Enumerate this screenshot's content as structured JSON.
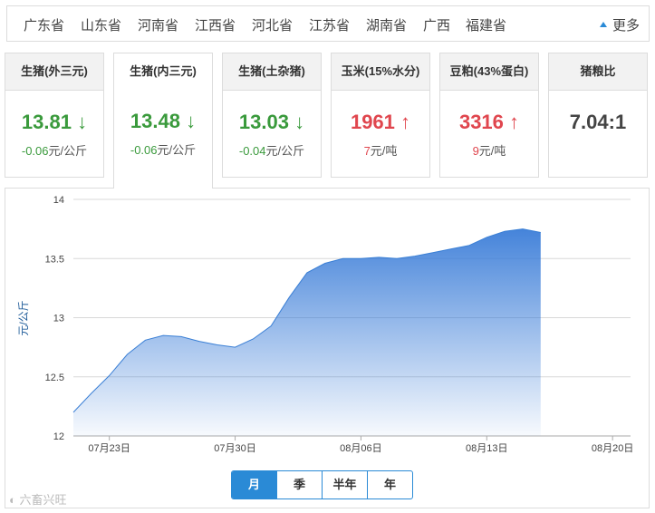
{
  "provinces": [
    "广东省",
    "山东省",
    "河南省",
    "江西省",
    "河北省",
    "江苏省",
    "湖南省",
    "广西",
    "福建省"
  ],
  "more_label": "更多",
  "cards": [
    {
      "title": "生猪(外三元)",
      "value": "13.81",
      "arrow": "↓",
      "change": "-0.06",
      "unit": "元/公斤",
      "trend": "down"
    },
    {
      "title": "生猪(内三元)",
      "value": "13.48",
      "arrow": "↓",
      "change": "-0.06",
      "unit": "元/公斤",
      "trend": "down"
    },
    {
      "title": "生猪(土杂猪)",
      "value": "13.03",
      "arrow": "↓",
      "change": "-0.04",
      "unit": "元/公斤",
      "trend": "down"
    },
    {
      "title": "玉米(15%水分)",
      "value": "1961",
      "arrow": "↑",
      "change": "7",
      "unit": "元/吨",
      "trend": "up"
    },
    {
      "title": "豆粕(43%蛋白)",
      "value": "3316",
      "arrow": "↑",
      "change": "9",
      "unit": "元/吨",
      "trend": "up"
    },
    {
      "title": "猪粮比",
      "value": "7.04:1",
      "arrow": "",
      "change": "",
      "unit": "",
      "trend": "neutral"
    }
  ],
  "active_card": 1,
  "range_buttons": [
    "月",
    "季",
    "半年",
    "年"
  ],
  "active_range": 0,
  "watermark": "六畜兴旺",
  "colors": {
    "accent": "#2a8ad6",
    "down": "#3a9a3c",
    "up": "#e0464e",
    "area_top": "#3b7dd8",
    "area_bottom": "#f4f8fd"
  },
  "chart_data": {
    "type": "area",
    "ylabel": "元/公斤",
    "ylim": [
      12,
      14
    ],
    "yticks": [
      "12",
      "12.5",
      "13",
      "13.5",
      "14"
    ],
    "xticks": [
      "07月23日",
      "07月30日",
      "08月06日",
      "08月13日",
      "08月20日"
    ],
    "x": [
      "07-21",
      "07-22",
      "07-23",
      "07-24",
      "07-25",
      "07-26",
      "07-27",
      "07-28",
      "07-29",
      "07-30",
      "07-31",
      "08-01",
      "08-02",
      "08-03",
      "08-04",
      "08-05",
      "08-06",
      "08-07",
      "08-08",
      "08-09",
      "08-10",
      "08-11",
      "08-12",
      "08-13",
      "08-14",
      "08-15",
      "08-16"
    ],
    "values": [
      12.2,
      12.36,
      12.51,
      12.69,
      12.81,
      12.85,
      12.84,
      12.8,
      12.77,
      12.75,
      12.82,
      12.93,
      13.17,
      13.38,
      13.46,
      13.5,
      13.5,
      13.51,
      13.5,
      13.52,
      13.55,
      13.58,
      13.61,
      13.68,
      13.73,
      13.75,
      13.72
    ],
    "grid": true
  }
}
